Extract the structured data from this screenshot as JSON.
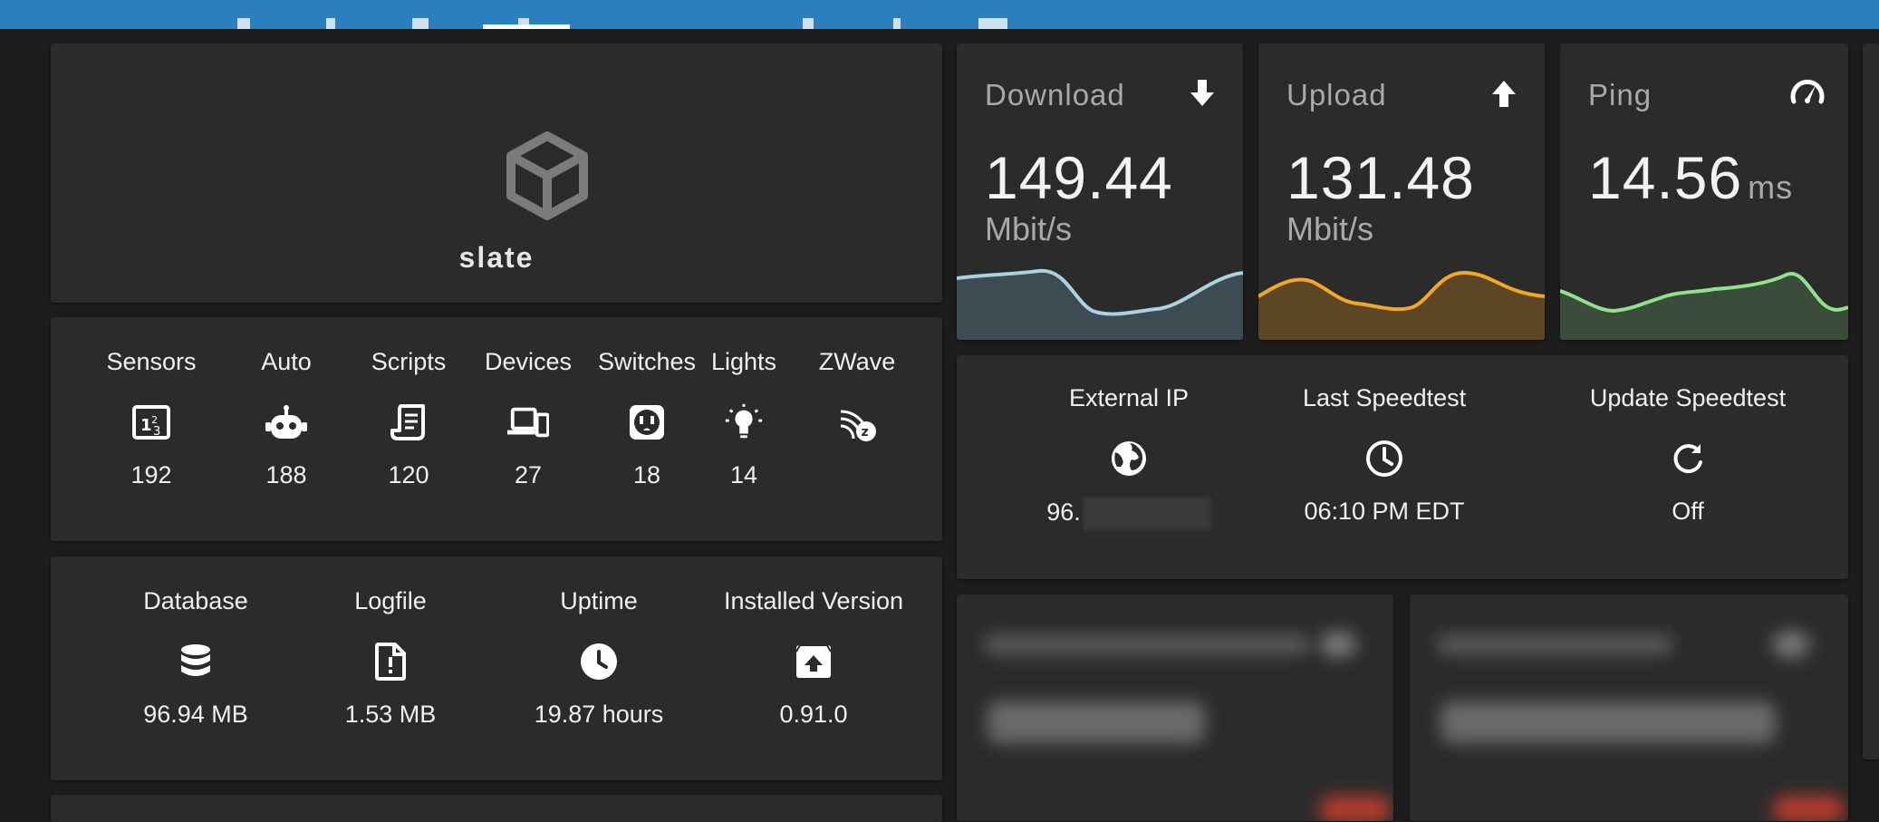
{
  "topbar": {
    "color": "#2a7fbd"
  },
  "instance": {
    "name": "slate",
    "icon": "cube-icon"
  },
  "counts": [
    {
      "label": "Sensors",
      "icon": "sensors-icon",
      "value": "192"
    },
    {
      "label": "Auto",
      "icon": "robot-icon",
      "value": "188"
    },
    {
      "label": "Scripts",
      "icon": "script-icon",
      "value": "120"
    },
    {
      "label": "Devices",
      "icon": "devices-icon",
      "value": "27"
    },
    {
      "label": "Switches",
      "icon": "outlet-icon",
      "value": "18"
    },
    {
      "label": "Lights",
      "icon": "lightbulb-icon",
      "value": "14"
    },
    {
      "label": "ZWave",
      "icon": "zwave-icon",
      "value": ""
    }
  ],
  "system": [
    {
      "label": "Database",
      "icon": "database-icon",
      "value": "96.94 MB"
    },
    {
      "label": "Logfile",
      "icon": "file-alert-icon",
      "value": "1.53 MB"
    },
    {
      "label": "Uptime",
      "icon": "clock-icon",
      "value": "19.87 hours"
    },
    {
      "label": "Installed Version",
      "icon": "package-up-icon",
      "value": "0.91.0"
    }
  ],
  "speedtest": {
    "download": {
      "title": "Download",
      "value": "149.44",
      "unit": "Mbit/s",
      "icon": "download-arrow-icon",
      "color": "#a9d2e2"
    },
    "upload": {
      "title": "Upload",
      "value": "131.48",
      "unit": "Mbit/s",
      "icon": "upload-arrow-icon",
      "color": "#f5a623"
    },
    "ping": {
      "title": "Ping",
      "value": "14.56",
      "unit": "ms",
      "icon": "speedometer-icon",
      "color": "#8fe38a"
    }
  },
  "network": [
    {
      "label": "External IP",
      "icon": "globe-icon",
      "value": "96."
    },
    {
      "label": "Last Speedtest",
      "icon": "clock-outline-icon",
      "value": "06:10 PM EDT"
    },
    {
      "label": "Update Speedtest",
      "icon": "refresh-icon",
      "value": "Off"
    }
  ]
}
